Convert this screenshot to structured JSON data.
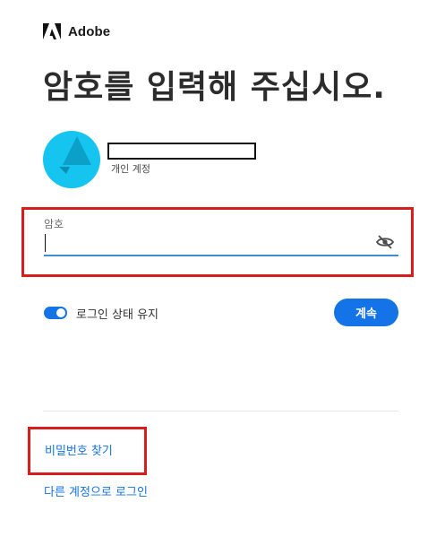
{
  "brand": {
    "name": "Adobe",
    "logo_icon": "adobe-logo-icon"
  },
  "title": "암호를 입력해 주십시오.",
  "account": {
    "type_label": "개인 계정",
    "avatar_color": "#16c4f0"
  },
  "password": {
    "label": "암호",
    "value": "",
    "placeholder": "",
    "visibility_icon": "eye-slash-icon"
  },
  "stay_signed_in": {
    "label": "로그인 상태 유지",
    "checked": true
  },
  "continue_button": {
    "label": "계속"
  },
  "links": {
    "forgot_password": "비밀번호 찾기",
    "other_account": "다른 계정으로 로그인"
  },
  "colors": {
    "accent": "#1473e6",
    "annotation": "#d81d1d",
    "input_underline": "#3f8fd6"
  }
}
